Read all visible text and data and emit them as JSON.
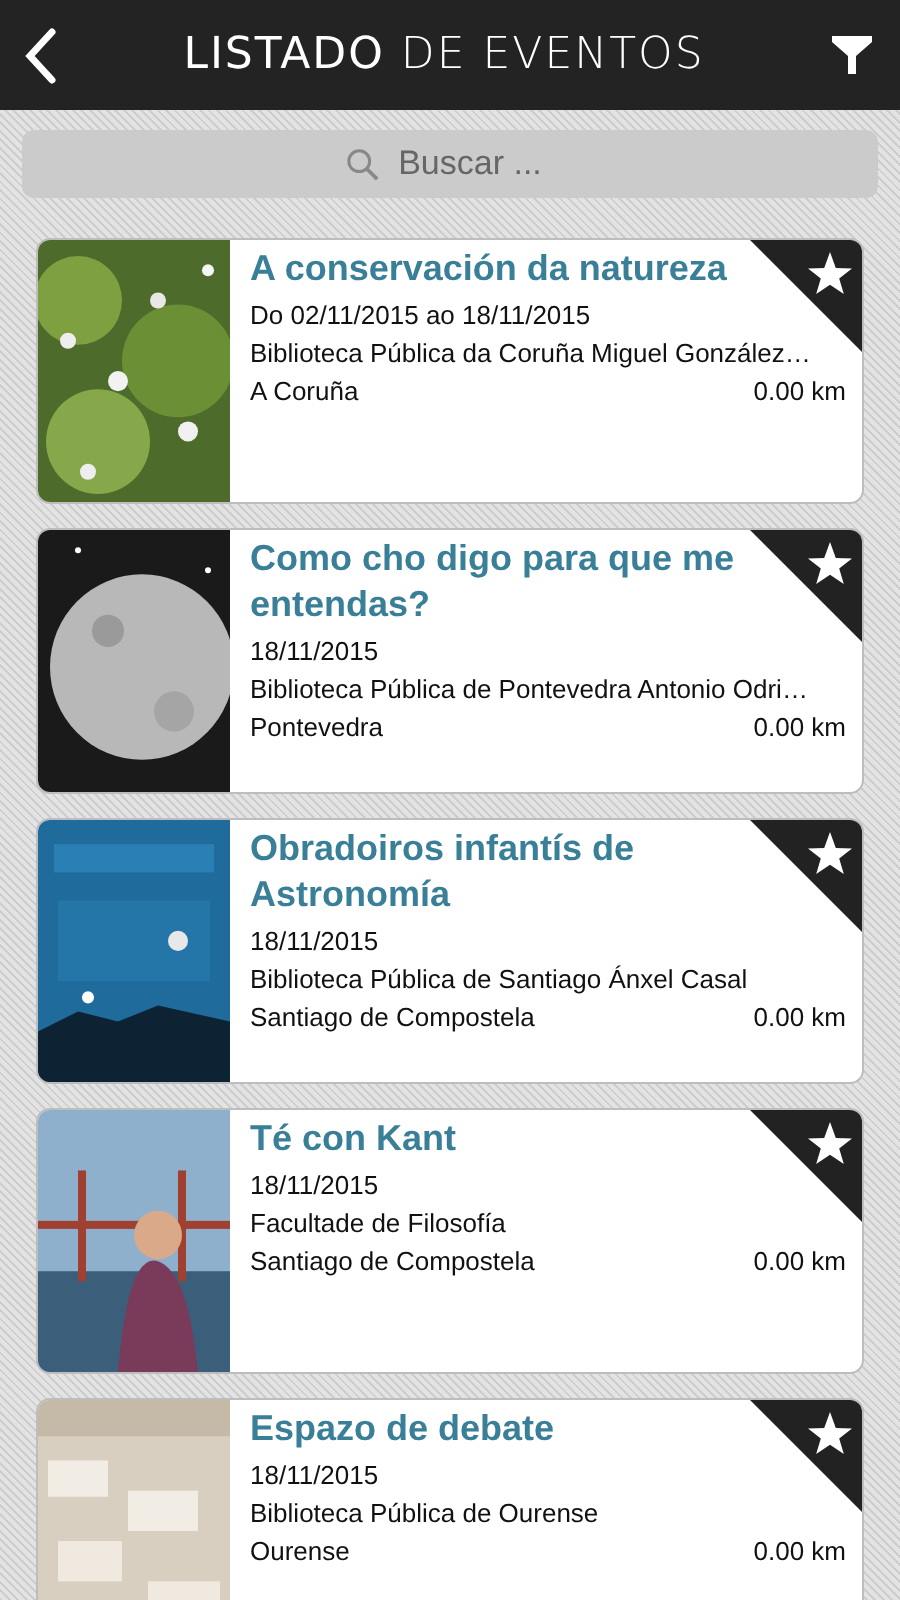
{
  "header": {
    "title": "**LISTADO** DE EVENTOS"
  },
  "search": {
    "placeholder": "Buscar ..."
  },
  "events": [
    {
      "title": "A conservación da natureza",
      "date": "Do 02/11/2015 ao 18/11/2015",
      "venue": "Biblioteca Pública da Coruña Miguel González…",
      "city": "A Coruña",
      "distance": "0.00 km"
    },
    {
      "title": "Como cho digo para que me entendas?",
      "date": "18/11/2015",
      "venue": "Biblioteca Pública de Pontevedra Antonio Odri…",
      "city": "Pontevedra",
      "distance": "0.00 km"
    },
    {
      "title": "Obradoiros infantís de Astronomía",
      "date": "18/11/2015",
      "venue": "Biblioteca Pública de Santiago Ánxel Casal",
      "city": "Santiago de Compostela",
      "distance": "0.00 km"
    },
    {
      "title": "Té con Kant",
      "date": "18/11/2015",
      "venue": "Facultade de Filosofía",
      "city": "Santiago de Compostela",
      "distance": "0.00 km"
    },
    {
      "title": "Espazo de debate",
      "date": "18/11/2015",
      "venue": "Biblioteca Pública de Ourense",
      "city": "Ourense",
      "distance": "0.00 km"
    }
  ]
}
